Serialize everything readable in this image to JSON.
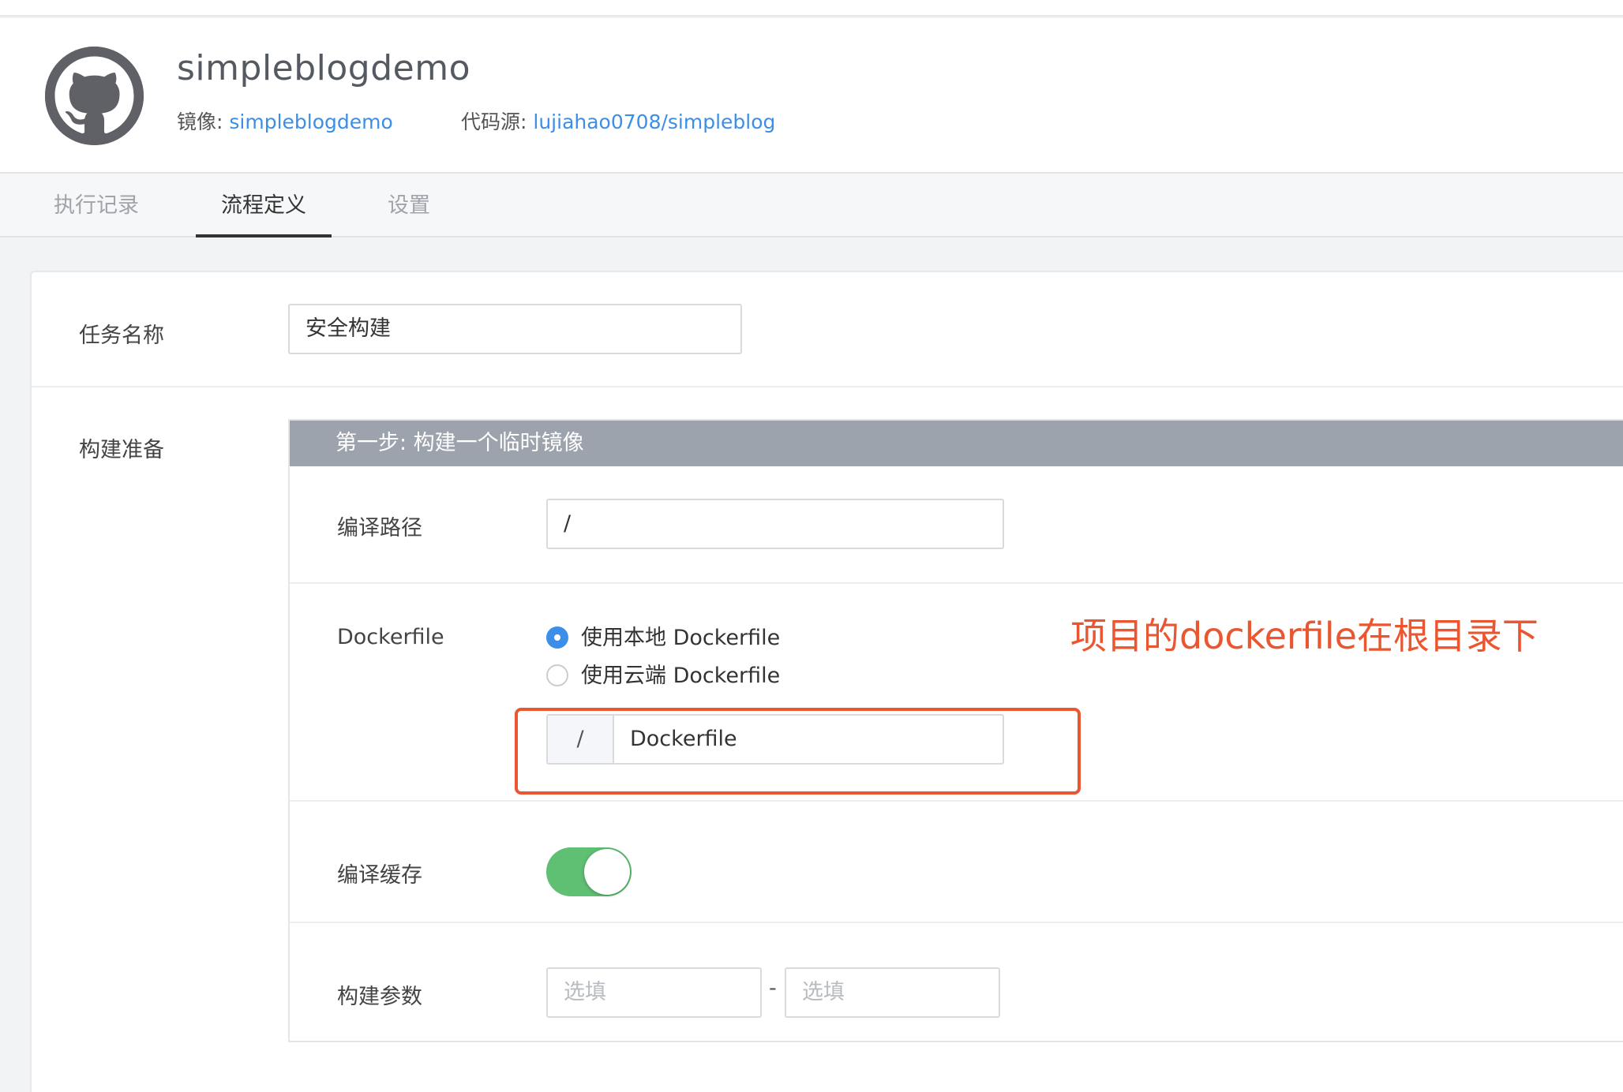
{
  "repo": {
    "name": "simpleblogdemo",
    "image_label": "镜像:",
    "image_value": "simpleblogdemo",
    "source_label": "代码源:",
    "source_value": "lujiahao0708/simpleblog"
  },
  "tabs": [
    {
      "label": "执行记录",
      "active": false
    },
    {
      "label": "流程定义",
      "active": true
    },
    {
      "label": "设置",
      "active": false
    }
  ],
  "form": {
    "task_name_label": "任务名称",
    "task_name_value": "安全构建",
    "build_prep_label": "构建准备",
    "step": {
      "title": "第一步: 构建一个临时镜像",
      "compile_path_label": "编译路径",
      "compile_path_value": "/",
      "dockerfile_label": "Dockerfile",
      "radio_options": [
        {
          "label": "使用本地 Dockerfile",
          "checked": true
        },
        {
          "label": "使用云端 Dockerfile",
          "checked": false
        }
      ],
      "dockerfile_prefix": "/",
      "dockerfile_value": "Dockerfile",
      "cache_label": "编译缓存",
      "cache_enabled": true,
      "params_label": "构建参数",
      "param_key_placeholder": "选填",
      "param_separator": "-",
      "param_value_placeholder": "选填"
    }
  },
  "annotation": {
    "text": "项目的dockerfile在根目录下",
    "color": "#ea5630"
  },
  "colors": {
    "link": "#3c8ee6",
    "step_header": "#9da3ac",
    "toggle_on": "#5fbf73",
    "radio_checked": "#3d8ee8"
  }
}
